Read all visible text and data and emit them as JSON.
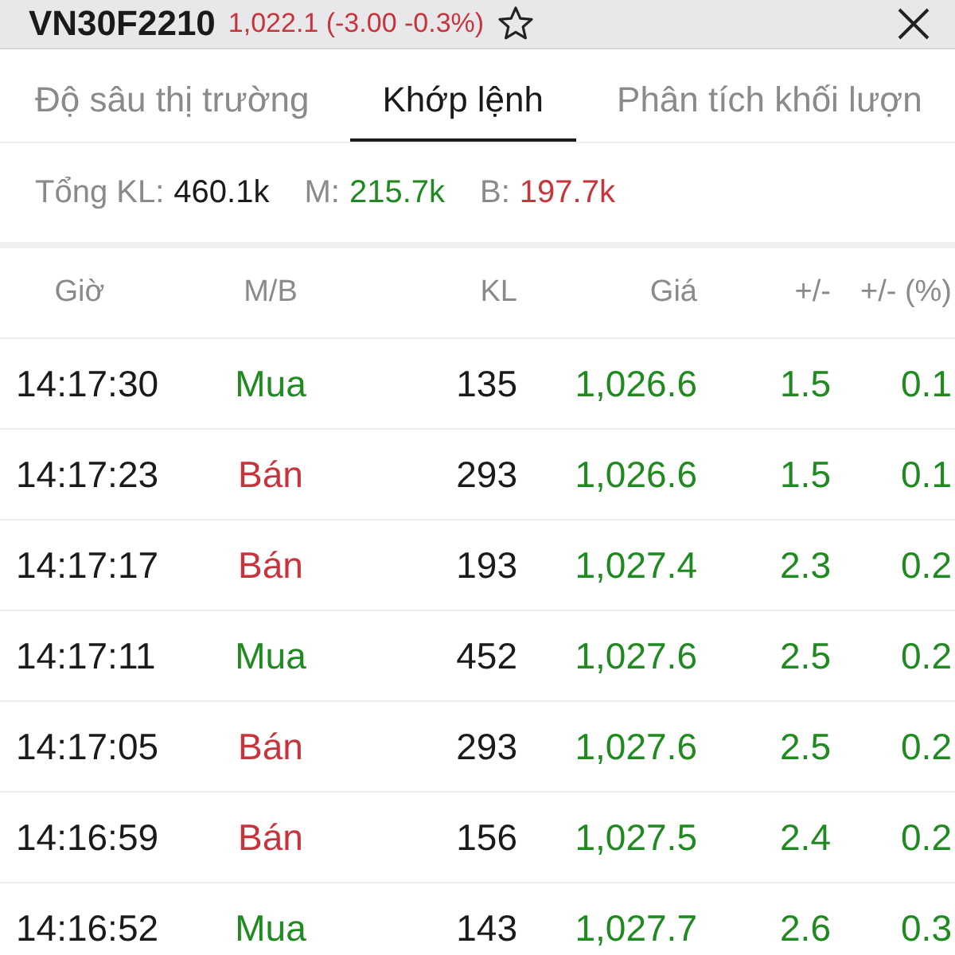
{
  "header": {
    "symbol": "VN30F2210",
    "quote": "1,022.1 (-3.00 -0.3%)",
    "favorite": false
  },
  "tabs": [
    {
      "label": "Độ sâu thị trường",
      "selected": false
    },
    {
      "label": "Khớp lệnh",
      "selected": true
    },
    {
      "label": "Phân tích khối lượn",
      "selected": false
    }
  ],
  "summary": {
    "total_label": "Tổng KL:",
    "total": "460.1k",
    "buy_label": "M:",
    "buy": "215.7k",
    "sell_label": "B:",
    "sell": "197.7k"
  },
  "table": {
    "columns": [
      "Giờ",
      "M/B",
      "KL",
      "Giá",
      "+/-",
      "+/- (%)"
    ],
    "rows": [
      {
        "time": "14:17:30",
        "side": "Mua",
        "kind": "buy",
        "volume": "135",
        "price": "1,026.6",
        "change": "1.5",
        "change_pct": "0.1"
      },
      {
        "time": "14:17:23",
        "side": "Bán",
        "kind": "sell",
        "volume": "293",
        "price": "1,026.6",
        "change": "1.5",
        "change_pct": "0.1"
      },
      {
        "time": "14:17:17",
        "side": "Bán",
        "kind": "sell",
        "volume": "193",
        "price": "1,027.4",
        "change": "2.3",
        "change_pct": "0.2"
      },
      {
        "time": "14:17:11",
        "side": "Mua",
        "kind": "buy",
        "volume": "452",
        "price": "1,027.6",
        "change": "2.5",
        "change_pct": "0.2"
      },
      {
        "time": "14:17:05",
        "side": "Bán",
        "kind": "sell",
        "volume": "293",
        "price": "1,027.6",
        "change": "2.5",
        "change_pct": "0.2"
      },
      {
        "time": "14:16:59",
        "side": "Bán",
        "kind": "sell",
        "volume": "156",
        "price": "1,027.5",
        "change": "2.4",
        "change_pct": "0.2"
      },
      {
        "time": "14:16:52",
        "side": "Mua",
        "kind": "buy",
        "volume": "143",
        "price": "1,027.7",
        "change": "2.6",
        "change_pct": "0.3"
      }
    ]
  }
}
